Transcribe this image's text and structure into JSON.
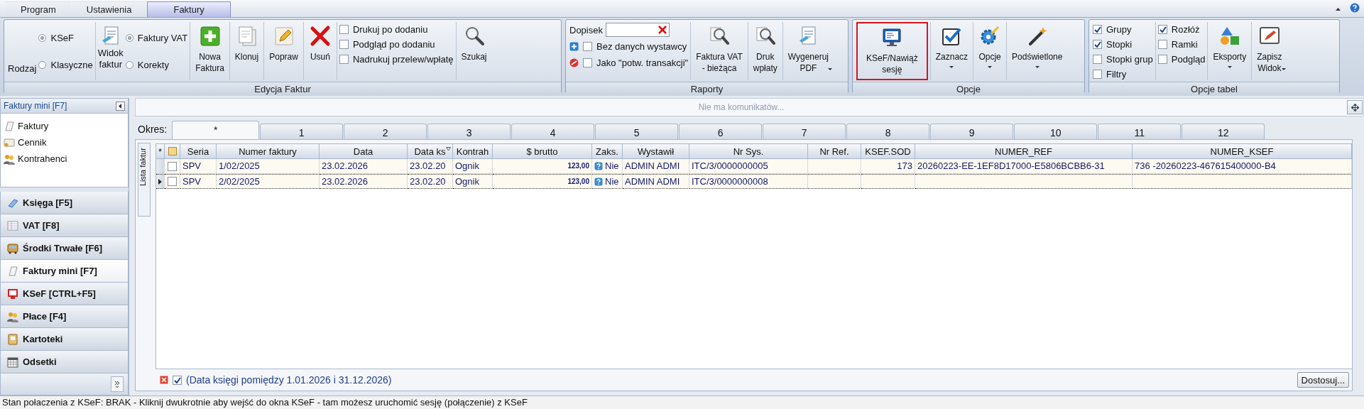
{
  "app_tabs": [
    {
      "label": "Program",
      "selected": false
    },
    {
      "label": "Ustawienia",
      "selected": false
    },
    {
      "label": "Faktury",
      "selected": true
    }
  ],
  "ribbon": {
    "groups": [
      {
        "label": "Edycja Faktur",
        "items": [
          {
            "kind": "caption",
            "label": "Rodzaj"
          },
          {
            "kind": "radios",
            "options": [
              {
                "label": "KSeF",
                "selected": true
              },
              {
                "label": "Klasyczne",
                "selected": false
              }
            ]
          },
          {
            "kind": "iconcaption",
            "label": "Widok\nfaktur"
          },
          {
            "kind": "radios",
            "options": [
              {
                "label": "Faktury VAT",
                "selected": true
              },
              {
                "label": "Korekty",
                "selected": false
              }
            ]
          },
          {
            "kind": "button",
            "label": "Nowa\nFaktura",
            "dropdown": false,
            "highlighted": false
          },
          {
            "kind": "button",
            "label": "Klonuj",
            "dropdown": false,
            "highlighted": false
          },
          {
            "kind": "button",
            "label": "Popraw",
            "dropdown": false,
            "highlighted": false
          },
          {
            "kind": "button",
            "label": "Usuń",
            "dropdown": false,
            "highlighted": false
          },
          {
            "kind": "checks",
            "options": [
              {
                "label": "Drukuj po dodaniu",
                "checked": false
              },
              {
                "label": "Podgląd po dodaniu",
                "checked": false
              },
              {
                "label": "Nadrukuj przelew/wpłatę",
                "checked": false
              }
            ]
          },
          {
            "kind": "button",
            "label": "Szukaj",
            "dropdown": false,
            "highlighted": false
          }
        ]
      },
      {
        "label": "Raporty",
        "items": [
          {
            "kind": "note",
            "field_label": "Dopisek",
            "options": [
              {
                "label": "Bez danych wystawcy",
                "checked": false
              },
              {
                "label": "Jako \"potw. transakcji\"",
                "checked": false
              }
            ]
          },
          {
            "kind": "button",
            "label": "Faktura VAT\n- bieżąca",
            "dropdown": false,
            "highlighted": false
          },
          {
            "kind": "button",
            "label": "Druk\nwpłaty",
            "dropdown": false,
            "highlighted": false
          },
          {
            "kind": "button",
            "label": "Wygeneruj\nPDF",
            "dropdown": true,
            "highlighted": false
          }
        ]
      },
      {
        "label": "Opcje",
        "items": [
          {
            "kind": "button",
            "label": "KSeF/Nawiąż\nsesję",
            "dropdown": false,
            "highlighted": true
          },
          {
            "kind": "button",
            "label": "Zaznacz",
            "dropdown": true,
            "highlighted": false
          },
          {
            "kind": "button",
            "label": "Opcje",
            "dropdown": true,
            "highlighted": false
          },
          {
            "kind": "button",
            "label": "Podświetlone",
            "dropdown": true,
            "highlighted": false
          }
        ]
      },
      {
        "label": "Opcje tabel",
        "items": [
          {
            "kind": "checks",
            "options": [
              {
                "label": "Grupy",
                "checked": true
              },
              {
                "label": "Stopki",
                "checked": true
              },
              {
                "label": "Stopki grup",
                "checked": false
              },
              {
                "label": "Filtry",
                "checked": false
              }
            ]
          },
          {
            "kind": "checks",
            "options": [
              {
                "label": "Rozłóż",
                "checked": true
              },
              {
                "label": "Ramki",
                "checked": false
              },
              {
                "label": "Podgląd",
                "checked": false
              }
            ]
          },
          {
            "kind": "button",
            "label": "Eksporty",
            "dropdown": true,
            "highlighted": false
          },
          {
            "kind": "button",
            "label": "Zapisz\nWidok",
            "dropdown": true,
            "highlighted": false
          }
        ]
      }
    ]
  },
  "sidebar": {
    "title": "Faktury mini [F7]",
    "items": [
      "Faktury",
      "Cennik",
      "Kontrahenci"
    ],
    "nav": [
      {
        "label": "Księga [F5]",
        "selected": false
      },
      {
        "label": "VAT [F8]",
        "selected": false
      },
      {
        "label": "Środki Trwałe [F6]",
        "selected": false
      },
      {
        "label": "Faktury mini [F7]",
        "selected": true
      },
      {
        "label": "KSeF [CTRL+F5]",
        "selected": false
      },
      {
        "label": "Płace [F4]",
        "selected": false
      },
      {
        "label": "Kartoteki",
        "selected": false
      },
      {
        "label": "Odsetki",
        "selected": false
      }
    ]
  },
  "messages": "Nie ma komunikatów...",
  "period": {
    "label": "Okres:",
    "tabs": [
      {
        "label": "*",
        "selected": true
      },
      {
        "label": "1",
        "selected": false
      },
      {
        "label": "2",
        "selected": false
      },
      {
        "label": "3",
        "selected": false
      },
      {
        "label": "4",
        "selected": false
      },
      {
        "label": "5",
        "selected": false
      },
      {
        "label": "6",
        "selected": false
      },
      {
        "label": "7",
        "selected": false
      },
      {
        "label": "8",
        "selected": false
      },
      {
        "label": "9",
        "selected": false
      },
      {
        "label": "10",
        "selected": false
      },
      {
        "label": "11",
        "selected": false
      },
      {
        "label": "12",
        "selected": false
      }
    ]
  },
  "side_tab": "Lista faktur",
  "table": {
    "corner": "*",
    "columns": [
      {
        "label": "Seria",
        "kind": "text",
        "filter": false
      },
      {
        "label": "Numer faktury",
        "kind": "text",
        "filter": false
      },
      {
        "label": "Data",
        "kind": "text",
        "filter": false
      },
      {
        "label": "Data ks",
        "kind": "text",
        "filter": true
      },
      {
        "label": "Kontrah",
        "kind": "text",
        "filter": false
      },
      {
        "label": "$ brutto",
        "kind": "amount",
        "filter": false
      },
      {
        "label": "Zaks.",
        "kind": "flag",
        "filter": false
      },
      {
        "label": "Wystawił",
        "kind": "text",
        "filter": false
      },
      {
        "label": "Nr Sys.",
        "kind": "text",
        "filter": false
      },
      {
        "label": "Nr Ref.",
        "kind": "text",
        "filter": false
      },
      {
        "label": "KSEF.SOD",
        "kind": "number",
        "filter": false
      },
      {
        "label": "NUMER_REF",
        "kind": "text",
        "filter": false
      },
      {
        "label": "NUMER_KSEF",
        "kind": "text",
        "filter": false
      }
    ],
    "rows": [
      {
        "selected": false,
        "checked": false,
        "cells": [
          "SPV",
          "1/02/2025",
          "23.02.2026",
          "23.02.20",
          "Ognik",
          "123,00",
          "Nie",
          "ADMIN ADMI",
          "ITC/3/0000000005",
          null,
          "173",
          "20260223-EE-1EF8D17000-E5806BCBB6-31",
          "736 -20260223-467615400000-B4"
        ]
      },
      {
        "selected": true,
        "checked": false,
        "cells": [
          "SPV",
          "2/02/2025",
          "23.02.2026",
          "23.02.20",
          "Ognik",
          "123,00",
          "Nie",
          "ADMIN ADMI",
          "ITC/3/0000000008",
          null,
          null,
          null,
          null
        ]
      }
    ]
  },
  "filter_bar": {
    "enabled": true,
    "text": "(Data księgi pomiędzy 1.01.2026 i 31.12.2026)",
    "button": "Dostosuj..."
  },
  "status_bar": "Stan połaczenia z KSeF: BRAK - Kliknij dwukrotnie aby wejść do okna KSeF - tam możesz uruchomić sesję (połączenie) z KSeF"
}
